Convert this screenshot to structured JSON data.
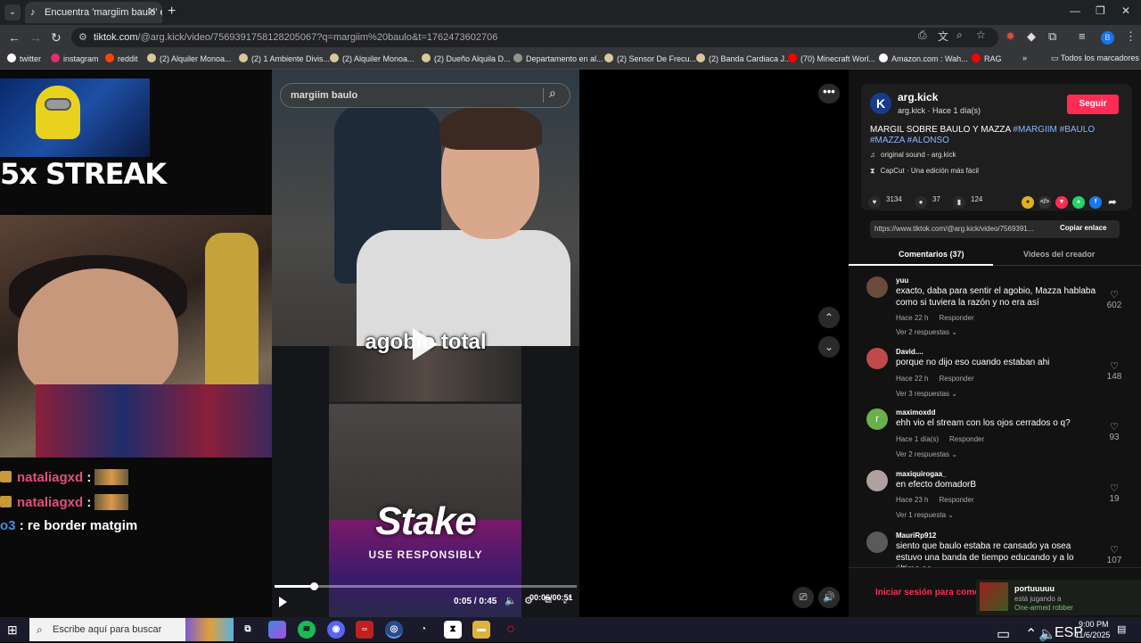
{
  "browser": {
    "tab_title": "Encuentra 'margiim baulo' en TikTok",
    "url_host": "tiktok.com",
    "url_path": "/@arg.kick/video/7569391758128205067?q=margiim%20baulo&t=1762473602706",
    "bookmarks": [
      {
        "label": "twitter",
        "icon": "x-logo",
        "color": "#ffffff"
      },
      {
        "label": "instagram",
        "icon": "instagram-logo",
        "color": "#e1306c"
      },
      {
        "label": "reddit",
        "icon": "reddit-logo",
        "color": "#ff4500"
      },
      {
        "label": "(2) Alquiler Monoa...",
        "icon": "marketplace-icon",
        "color": "#d8c89a"
      },
      {
        "label": "(2) 1 Ambiente Divis...",
        "icon": "marketplace-icon",
        "color": "#d8c89a"
      },
      {
        "label": "(2) Alquiler Monoa...",
        "icon": "marketplace-icon",
        "color": "#d8c89a"
      },
      {
        "label": "(2) Dueño Alquila D...",
        "icon": "marketplace-icon",
        "color": "#d8c89a"
      },
      {
        "label": "Departamento en al...",
        "icon": "image-icon",
        "color": "#8a9a8a"
      },
      {
        "label": "(2) Sensor De Frecu...",
        "icon": "marketplace-icon",
        "color": "#d8c89a"
      },
      {
        "label": "(2) Banda Cardiaca J...",
        "icon": "marketplace-icon",
        "color": "#d8c89a"
      },
      {
        "label": "(70) Minecraft Worl...",
        "icon": "youtube-logo",
        "color": "#ff0000"
      },
      {
        "label": "Amazon.com : Wah...",
        "icon": "amazon-logo",
        "color": "#ffffff"
      },
      {
        "label": "RAG",
        "icon": "youtube-logo",
        "color": "#ff0000"
      }
    ],
    "all_bookmarks": "Todos los marcadores",
    "profile_initial": "B"
  },
  "stream": {
    "streak_text": "5x STREAK",
    "chat": [
      {
        "user": "nataliagxd",
        "sep": ":",
        "msg": ""
      },
      {
        "user": "nataliagxd",
        "sep": ":",
        "msg": ""
      },
      {
        "user": "o3",
        "sep": ":",
        "msg": "re border matgim"
      }
    ]
  },
  "player": {
    "search_value": "margiim baulo",
    "caption": "agobio total",
    "stake_text": "Stake",
    "responsibly_text": "USE RESPONSIBLY",
    "overlay_time": "00:06/00:51",
    "time": "0:05 / 0:45",
    "progress": 0.13
  },
  "creator": {
    "avatar_letter": "K",
    "name": "arg.kick",
    "meta": "arg.kick · Hace 1 día(s)",
    "follow_label": "Seguir",
    "desc_text": "MARGIL SOBRE BAULO Y MAZZA",
    "hashtags": "#MARGIIM #BAULO #MAZZA #ALONSO",
    "sound": "original sound - arg.kick",
    "capcut": "CapCut · Una edición más fácil"
  },
  "actions": {
    "likes": "3134",
    "comments": "37",
    "saves": "124"
  },
  "share": {
    "link": "https://www.tiktok.com/@arg.kick/video/7569391...",
    "copy_label": "Copiar enlace"
  },
  "tabs": {
    "comments": "Comentarios (37)",
    "videos": "Videos del creador"
  },
  "comments": [
    {
      "user": "yuu",
      "text": "exacto, daba para sentir el agobio, Mazza hablaba como si tuviera la razón y no era así",
      "time": "Hace 22 h",
      "reply": "Responder",
      "replies": "Ver 2 respuestas",
      "likes": "602",
      "avatar_color": "#6a4a3a"
    },
    {
      "user": "David....",
      "text": "porque no dijo eso cuando estaban ahi",
      "time": "Hace 22 h",
      "reply": "Responder",
      "replies": "Ver 3 respuestas",
      "likes": "148",
      "avatar_color": "#c04a4a"
    },
    {
      "user": "maximoxdd",
      "text": "ehh vio el stream con los ojos cerrados o q?",
      "time": "Hace 1 día(s)",
      "reply": "Responder",
      "replies": "Ver 2 respuestas",
      "likes": "93",
      "avatar_color": "#6ab04a",
      "avatar_letter": "r"
    },
    {
      "user": "maxiquirogaa_",
      "text": "en efecto domadorB",
      "time": "Hace 23 h",
      "reply": "Responder",
      "replies": "Ver 1 respuesta",
      "likes": "19",
      "avatar_color": "#b0a0a0"
    },
    {
      "user": "MauriRp912",
      "text": "siento que baulo estaba re cansado ya osea estuvo una banda de tiempo educando y a lo último se",
      "likes": "107",
      "avatar_color": "#5a5a5a"
    }
  ],
  "login_text": "Iniciar sesión para comentar",
  "toast": {
    "user": "portuuuuu",
    "status": "está jugando a",
    "game": "One-armed robber"
  },
  "taskbar": {
    "search_placeholder": "Escribe aquí para buscar",
    "lang": "ESP",
    "time": "9:00 PM",
    "date": "11/6/2025"
  }
}
